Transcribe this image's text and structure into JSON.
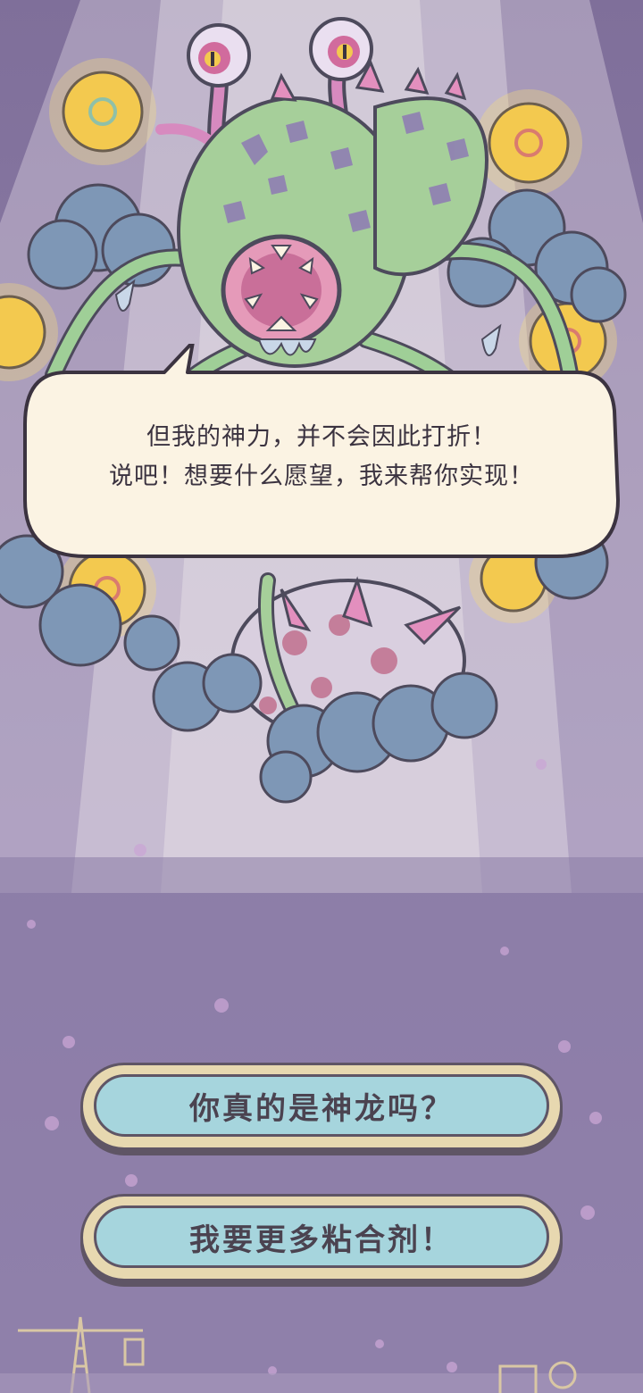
{
  "scene": {
    "name": "dragon-wish-scene"
  },
  "dialogue": {
    "lines": [
      "但我的神力，并不会因此打折！",
      "说吧！想要什么愿望，我来帮你实现！"
    ]
  },
  "options": [
    {
      "label": "你真的是神龙吗？"
    },
    {
      "label": "我要更多粘合剂！"
    }
  ],
  "colors": {
    "background": "#8a7aa4",
    "bubble": "#fbf3e3",
    "button_face": "#a6d5dd",
    "button_rim": "#e7d8b0",
    "outline": "#5f5565"
  },
  "icons": [
    "glowing-orb-icon",
    "eyeball-icon",
    "cloud-icon",
    "crane-icon"
  ]
}
